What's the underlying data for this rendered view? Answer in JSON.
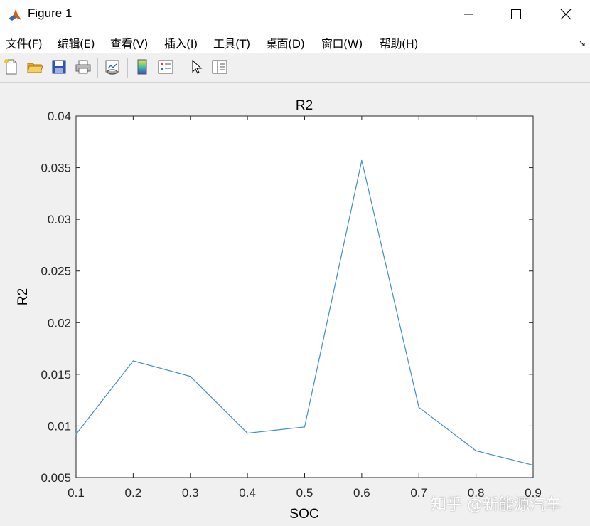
{
  "window": {
    "title": "Figure 1"
  },
  "menu": [
    "文件(F)",
    "编辑(E)",
    "查看(V)",
    "插入(I)",
    "工具(T)",
    "桌面(D)",
    "窗口(W)",
    "帮助(H)"
  ],
  "toolbar": [
    "new-figure-icon",
    "open-file-icon",
    "save-icon",
    "print-icon",
    "link-plot-icon",
    "colorbar-icon",
    "legend-icon",
    "edit-plot-icon",
    "property-inspector-icon"
  ],
  "chart_data": {
    "type": "line",
    "title": "R2",
    "xlabel": "SOC",
    "ylabel": "R2",
    "x": [
      0.1,
      0.2,
      0.3,
      0.4,
      0.5,
      0.6,
      0.7,
      0.8,
      0.9
    ],
    "series": [
      {
        "values": [
          0.0092,
          0.0163,
          0.0148,
          0.0093,
          0.0099,
          0.0357,
          0.0118,
          0.0076,
          0.0062
        ],
        "color": "#3e8fc6"
      }
    ],
    "xlim": [
      0.1,
      0.9
    ],
    "ylim": [
      0.005,
      0.04
    ],
    "xticks": [
      "0.1",
      "0.2",
      "0.3",
      "0.4",
      "0.5",
      "0.6",
      "0.7",
      "0.8",
      "0.9"
    ],
    "yticks": [
      "0.005",
      "0.01",
      "0.015",
      "0.02",
      "0.025",
      "0.03",
      "0.035",
      "0.04"
    ],
    "grid": false
  },
  "watermark": "知乎 @新能源汽车"
}
